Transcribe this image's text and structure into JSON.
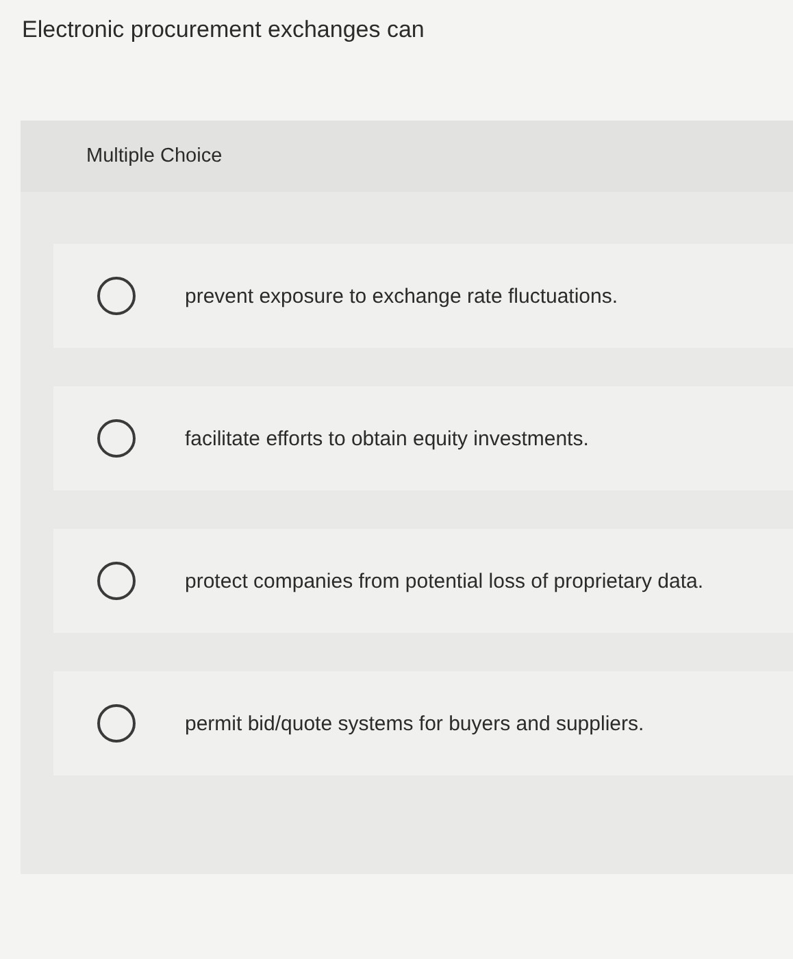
{
  "question": "Electronic procurement exchanges can",
  "section": {
    "label": "Multiple Choice"
  },
  "options": [
    {
      "text": "prevent exposure to exchange rate fluctuations.",
      "selected": false
    },
    {
      "text": "facilitate efforts to obtain equity investments.",
      "selected": false
    },
    {
      "text": "protect companies from potential loss of proprietary data.",
      "selected": false
    },
    {
      "text": "permit bid/quote systems for buyers and suppliers.",
      "selected": false
    }
  ]
}
